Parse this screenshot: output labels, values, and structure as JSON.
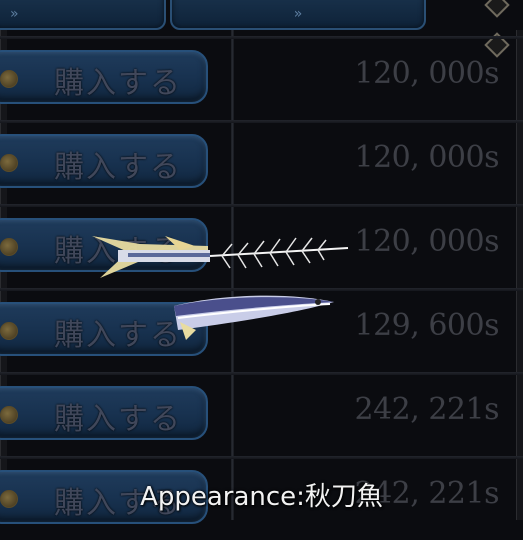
{
  "top_bar": {
    "left_button": "»",
    "right_button": "»"
  },
  "rows": [
    {
      "buy_label": "購入する",
      "price": "120, 000s"
    },
    {
      "buy_label": "購入する",
      "price": "120, 000s"
    },
    {
      "buy_label": "購入する",
      "price": "120, 000s"
    },
    {
      "buy_label": "購入する",
      "price": "129, 600s"
    },
    {
      "buy_label": "購入する",
      "price": "242, 221s"
    },
    {
      "buy_label": "購入する",
      "price": "242, 221s"
    }
  ],
  "caption": "Appearance:秋刀魚",
  "icons": {
    "coin": "coin-icon",
    "fish_skeleton": "fish-skeleton-icon",
    "fish": "saury-fish-icon"
  }
}
